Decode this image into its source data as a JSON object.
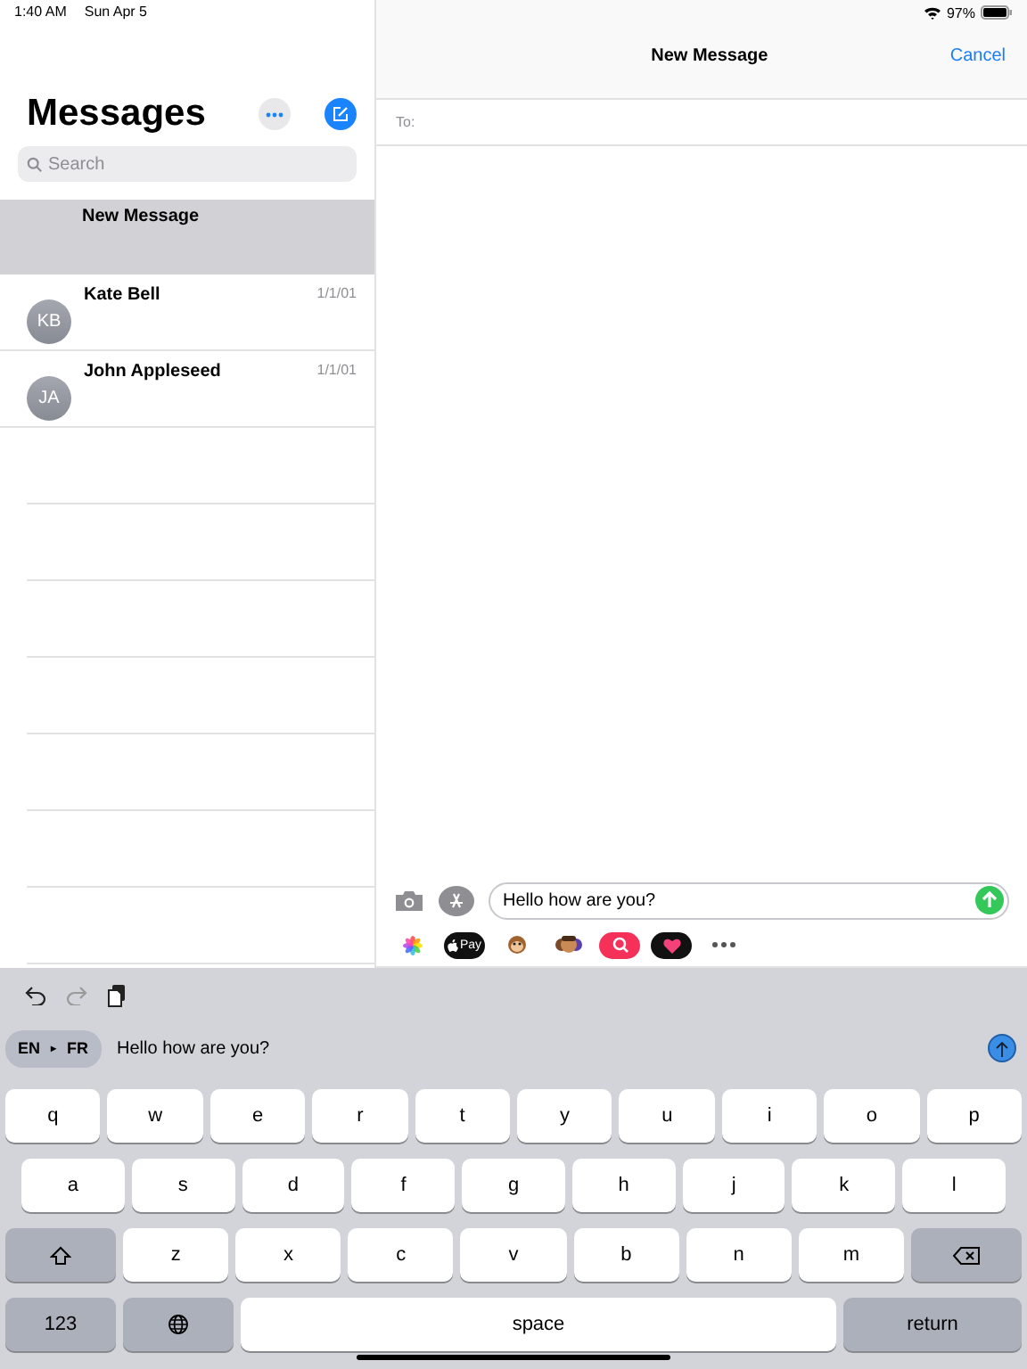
{
  "status_bar": {
    "time": "1:40 AM",
    "date": "Sun Apr 5",
    "battery": "97%"
  },
  "sidebar": {
    "title": "Messages",
    "search": {
      "placeholder": "Search"
    },
    "items": [
      {
        "kind": "draft",
        "name": "New Message",
        "selected": true
      },
      {
        "kind": "contact",
        "name": "Kate Bell",
        "initials": "KB",
        "date": "1/1/01",
        "selected": false
      },
      {
        "kind": "contact",
        "name": "John Appleseed",
        "initials": "JA",
        "date": "1/1/01",
        "selected": false
      }
    ]
  },
  "compose": {
    "title": "New Message",
    "cancel": "Cancel",
    "to_label": "To:",
    "message": "Hello how are you?",
    "apps": [
      {
        "kind": "photos"
      },
      {
        "kind": "pay",
        "label": "Pay"
      },
      {
        "kind": "monkey"
      },
      {
        "kind": "memoji"
      },
      {
        "kind": "search"
      },
      {
        "kind": "heart"
      },
      {
        "kind": "more"
      }
    ]
  },
  "keyboard": {
    "translation": {
      "source": "EN",
      "arrow": "▸",
      "target": "FR",
      "text": "Hello how are you?"
    },
    "rows": [
      [
        {
          "kind": "letter",
          "label": "q"
        },
        {
          "kind": "letter",
          "label": "w"
        },
        {
          "kind": "letter",
          "label": "e"
        },
        {
          "kind": "letter",
          "label": "r"
        },
        {
          "kind": "letter",
          "label": "t"
        },
        {
          "kind": "letter",
          "label": "y"
        },
        {
          "kind": "letter",
          "label": "u"
        },
        {
          "kind": "letter",
          "label": "i"
        },
        {
          "kind": "letter",
          "label": "o"
        },
        {
          "kind": "letter",
          "label": "p"
        }
      ],
      [
        {
          "kind": "letter",
          "label": "a"
        },
        {
          "kind": "letter",
          "label": "s"
        },
        {
          "kind": "letter",
          "label": "d"
        },
        {
          "kind": "letter",
          "label": "f"
        },
        {
          "kind": "letter",
          "label": "g"
        },
        {
          "kind": "letter",
          "label": "h"
        },
        {
          "kind": "letter",
          "label": "j"
        },
        {
          "kind": "letter",
          "label": "k"
        },
        {
          "kind": "letter",
          "label": "l"
        }
      ],
      [
        {
          "kind": "shift"
        },
        {
          "kind": "letter",
          "label": "z"
        },
        {
          "kind": "letter",
          "label": "x"
        },
        {
          "kind": "letter",
          "label": "c"
        },
        {
          "kind": "letter",
          "label": "v"
        },
        {
          "kind": "letter",
          "label": "b"
        },
        {
          "kind": "letter",
          "label": "n"
        },
        {
          "kind": "letter",
          "label": "m"
        },
        {
          "kind": "delete"
        }
      ],
      [
        {
          "kind": "numbers",
          "label": "123"
        },
        {
          "kind": "globe"
        },
        {
          "kind": "space",
          "label": "space"
        },
        {
          "kind": "return",
          "label": "return"
        }
      ]
    ]
  }
}
